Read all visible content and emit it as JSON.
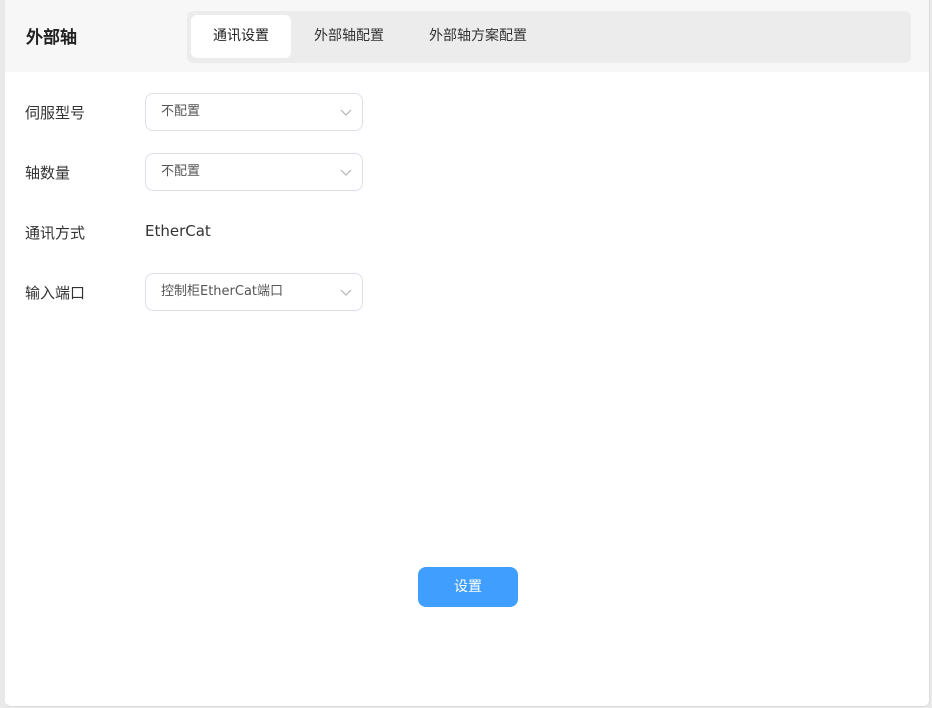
{
  "header": {
    "title": "外部轴"
  },
  "tabs": [
    {
      "label": "通讯设置",
      "active": true
    },
    {
      "label": "外部轴配置",
      "active": false
    },
    {
      "label": "外部轴方案配置",
      "active": false
    }
  ],
  "form": {
    "servo_model": {
      "label": "伺服型号",
      "value": "不配置"
    },
    "axis_count": {
      "label": "轴数量",
      "value": "不配置"
    },
    "comm_method": {
      "label": "通讯方式",
      "value": "EtherCat"
    },
    "input_port": {
      "label": "输入端口",
      "value": "控制柜EtherCat端口"
    }
  },
  "actions": {
    "submit_label": "设置"
  },
  "colors": {
    "primary": "#409eff",
    "tab_bar_bg": "#ececec",
    "header_bg": "#f7f7f7"
  },
  "icons": {
    "select_arrow": "chevron-down-icon"
  }
}
